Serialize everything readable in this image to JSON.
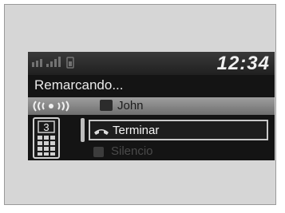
{
  "status": {
    "time": "12:34"
  },
  "call": {
    "status_text": "Remarcando...",
    "contact_name": "John",
    "line_number": "3"
  },
  "menu": {
    "items": [
      {
        "label": "Terminar",
        "icon": "hang-up-icon",
        "selected": true
      },
      {
        "label": "Silencio",
        "icon": "mute-icon",
        "selected": false
      }
    ]
  }
}
